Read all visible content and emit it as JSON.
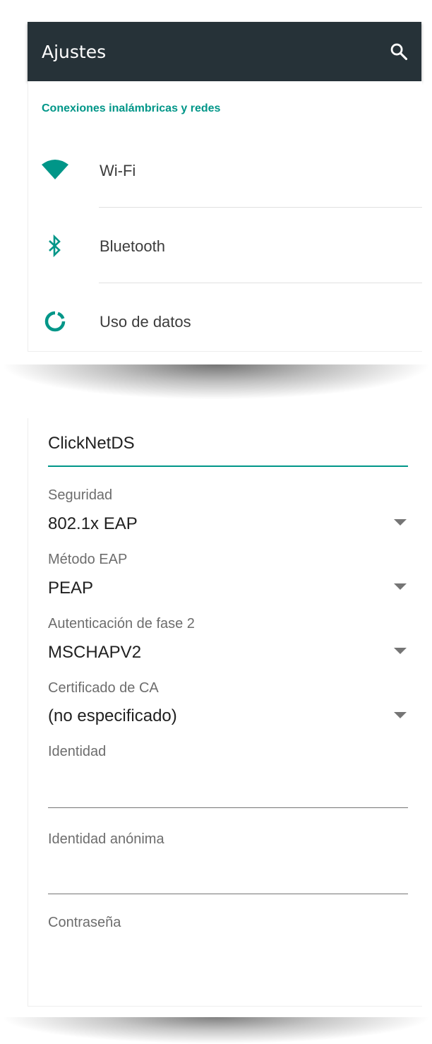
{
  "appbar": {
    "title": "Ajustes",
    "search_icon": "search-icon"
  },
  "section": {
    "header": "Conexiones inalámbricas y redes"
  },
  "settings_items": [
    {
      "icon": "wifi-icon",
      "label": "Wi-Fi"
    },
    {
      "icon": "bluetooth-icon",
      "label": "Bluetooth"
    },
    {
      "icon": "data-usage-icon",
      "label": "Uso de datos"
    }
  ],
  "wifi_form": {
    "ssid_value": "ClickNetDS",
    "security": {
      "label": "Seguridad",
      "value": "802.1x EAP"
    },
    "eap_method": {
      "label": "Método EAP",
      "value": "PEAP"
    },
    "phase2_auth": {
      "label": "Autenticación de fase 2",
      "value": "MSCHAPV2"
    },
    "ca_certificate": {
      "label": "Certificado de CA",
      "value": "(no especificado)"
    },
    "identity": {
      "label": "Identidad",
      "value": ""
    },
    "anonymous_identity": {
      "label": "Identidad anónima",
      "value": ""
    },
    "password": {
      "label": "Contraseña",
      "value": ""
    }
  },
  "colors": {
    "appbar": "#263238",
    "accent": "#009688",
    "text_primary": "#212121",
    "text_secondary": "#6d6d6d"
  }
}
